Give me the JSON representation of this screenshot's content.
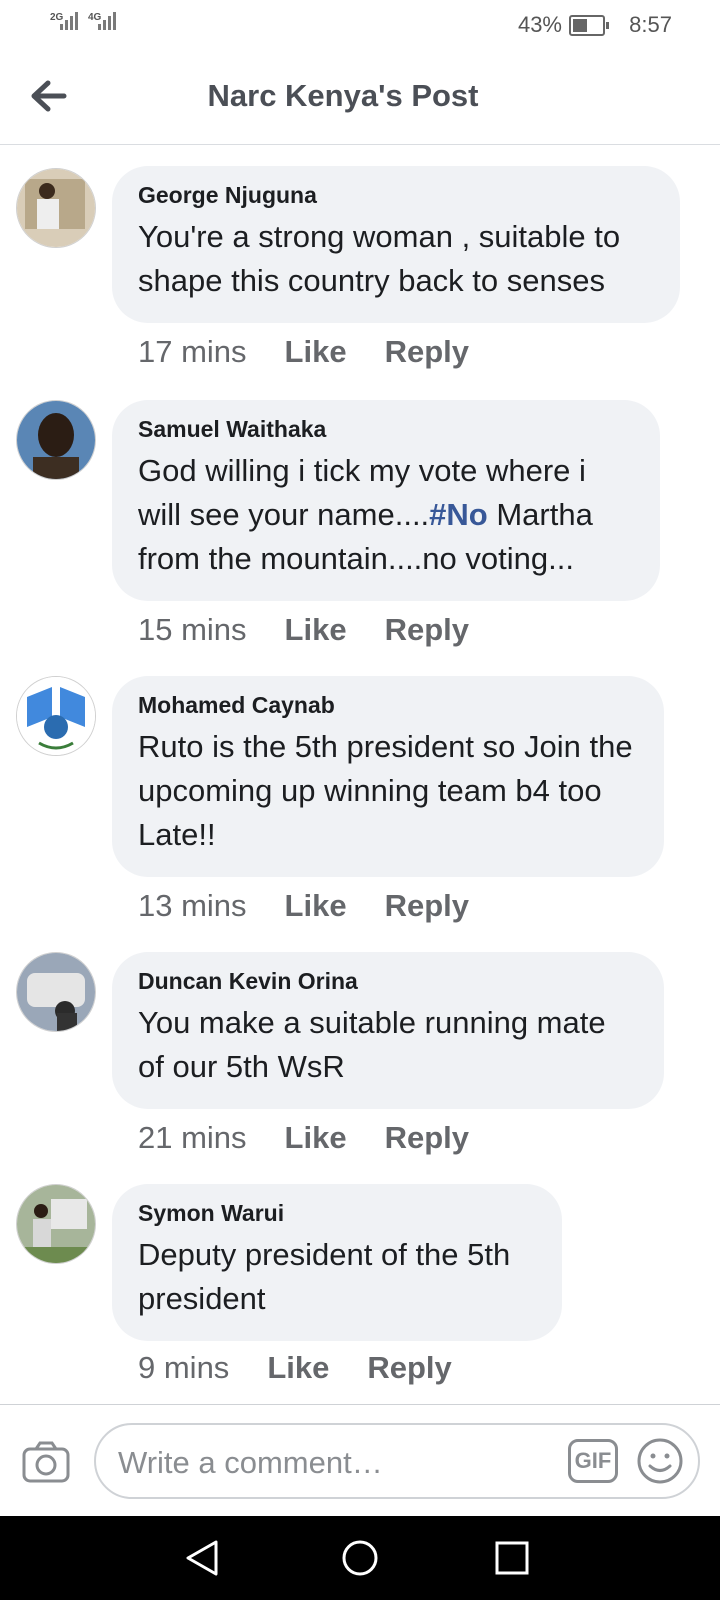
{
  "status": {
    "signal1": "2G",
    "signal2": "4G",
    "battery": "43%",
    "time": "8:57"
  },
  "header": {
    "title": "Narc Kenya's Post"
  },
  "comments": [
    {
      "author": "George Njuguna",
      "text": "You're a strong woman , suitable to shape this country back to senses",
      "time": "17 mins",
      "like": "Like",
      "reply": "Reply"
    },
    {
      "author": "Samuel Waithaka",
      "text_before": "God willing i tick my vote where i will see your name....",
      "hashtag": "#No",
      "text_after": " Martha from the mountain....no voting...",
      "time": "15 mins",
      "like": "Like",
      "reply": "Reply"
    },
    {
      "author": "Mohamed Caynab",
      "text": "Ruto is the 5th president so Join the upcoming up winning team b4 too Late!!",
      "time": "13 mins",
      "like": "Like",
      "reply": "Reply"
    },
    {
      "author": "Duncan Kevin Orina",
      "text": "You make a suitable running mate of our 5th WsR",
      "time": "21 mins",
      "like": "Like",
      "reply": "Reply"
    },
    {
      "author": "Symon Warui",
      "text": "Deputy president of the 5th president",
      "time": "9 mins",
      "like": "Like",
      "reply": "Reply"
    }
  ],
  "composer": {
    "placeholder": "Write a comment…",
    "gif_label": "GIF"
  },
  "colors": {
    "bubble": "#f0f2f5",
    "hashtag": "#385898",
    "meta": "#65676b"
  }
}
